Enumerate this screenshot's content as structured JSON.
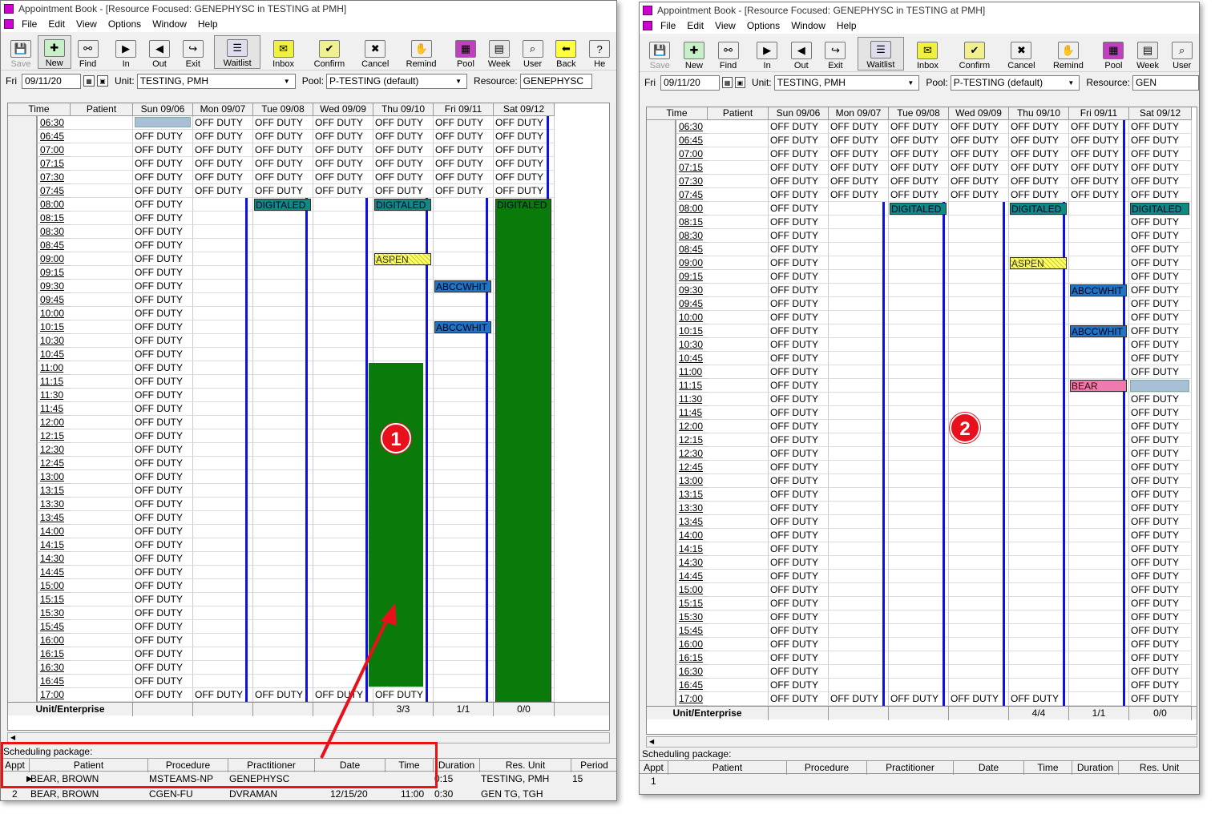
{
  "windows": [
    {
      "title": "Appointment Book - [Resource Focused:  GENEPHYSC in TESTING at PMH]",
      "menu": [
        "File",
        "Edit",
        "View",
        "Options",
        "Window",
        "Help"
      ],
      "toolbar": [
        {
          "label": "Save",
          "icon": "save-icon",
          "state": "disabled"
        },
        {
          "label": "New",
          "icon": "new-appointment-icon",
          "state": "pressed"
        },
        {
          "label": "Find",
          "icon": "binoculars-icon",
          "state": "normal"
        },
        {
          "label": "In",
          "icon": "check-in-icon",
          "state": "normal"
        },
        {
          "label": "Out",
          "icon": "check-out-icon",
          "state": "normal"
        },
        {
          "label": "Exit",
          "icon": "exit-icon",
          "state": "normal"
        },
        {
          "label": "Waitlist",
          "icon": "waitlist-icon",
          "state": "pressed"
        },
        {
          "label": "Inbox",
          "icon": "inbox-icon",
          "state": "normal"
        },
        {
          "label": "Confirm",
          "icon": "confirm-icon",
          "state": "normal"
        },
        {
          "label": "Cancel",
          "icon": "cancel-basket-icon",
          "state": "normal"
        },
        {
          "label": "Remind",
          "icon": "remind-icon",
          "state": "normal"
        },
        {
          "label": "Pool",
          "icon": "pool-grid-icon",
          "state": "normal"
        },
        {
          "label": "Week",
          "icon": "week-grid-icon",
          "state": "normal"
        },
        {
          "label": "User",
          "icon": "user-magnifier-icon",
          "state": "normal"
        },
        {
          "label": "Back",
          "icon": "back-arrow-icon",
          "state": "normal"
        },
        {
          "label": "He",
          "icon": "help-icon",
          "state": "normal"
        }
      ],
      "filter": {
        "day": "Fri",
        "date": "09/11/20",
        "unit_label": "Unit:",
        "unit": "TESTING, PMH",
        "pool_label": "Pool:",
        "pool": "P-TESTING (default)",
        "resource_label": "Resource:",
        "resource": "GENEPHYSC"
      },
      "columns": [
        "Time",
        "Patient",
        "Sun 09/06",
        "Mon 09/07",
        "Tue 09/08",
        "Wed 09/09",
        "Thu 09/10",
        "Fri 09/11",
        "Sat 09/12"
      ],
      "off_duty": "OFF DUTY",
      "appointments": [
        {
          "day": 2,
          "start": 6,
          "rows": 1,
          "text": "DIGITALED",
          "style": "teal"
        },
        {
          "day": 4,
          "start": 6,
          "rows": 1,
          "text": "DIGITALED",
          "style": "teal"
        },
        {
          "day": 6,
          "start": 6,
          "rows": 37,
          "text": "DIGITALED",
          "style": "teal-tall"
        },
        {
          "day": 4,
          "start": 10,
          "rows": 1,
          "text": "ASPEN",
          "style": "hatch"
        },
        {
          "day": 5,
          "start": 12,
          "rows": 1,
          "text": "ABCCWHIT",
          "style": "blue"
        },
        {
          "day": 5,
          "start": 15,
          "rows": 1,
          "text": "ABCCWHIT",
          "style": "blue"
        }
      ],
      "footer": {
        "label": "Unit/Enterprise",
        "counts": [
          "",
          "",
          "",
          "",
          "3/3",
          "1/1",
          "0/0"
        ]
      },
      "package": {
        "label": "Scheduling package:",
        "headers": [
          "Appt",
          "Patient",
          "Procedure",
          "Practitioner",
          "Date",
          "Time",
          "Duration",
          "Res. Unit",
          "Period"
        ],
        "rows": [
          {
            "appt": "",
            "patient": "BEAR, BROWN",
            "procedure": "MSTEAMS-NP",
            "practitioner": "GENEPHYSC",
            "date": "",
            "time": "",
            "duration": "0:15",
            "unit": "TESTING, PMH",
            "period": "15"
          },
          {
            "appt": "2",
            "patient": "BEAR, BROWN",
            "procedure": "CGEN-FU",
            "practitioner": "DVRAMAN",
            "date": "12/15/20",
            "time": "11:00",
            "duration": "0:30",
            "unit": "GEN TG, TGH",
            "period": ""
          }
        ]
      },
      "badge": "1"
    },
    {
      "title": "Appointment Book - [Resource Focused:  GENEPHYSC in TESTING at PMH]",
      "menu": [
        "File",
        "Edit",
        "View",
        "Options",
        "Window",
        "Help"
      ],
      "toolbar": [
        {
          "label": "Save",
          "icon": "save-icon",
          "state": "disabled"
        },
        {
          "label": "New",
          "icon": "new-appointment-icon",
          "state": "normal"
        },
        {
          "label": "Find",
          "icon": "binoculars-icon",
          "state": "normal"
        },
        {
          "label": "In",
          "icon": "check-in-icon",
          "state": "normal"
        },
        {
          "label": "Out",
          "icon": "check-out-icon",
          "state": "normal"
        },
        {
          "label": "Exit",
          "icon": "exit-icon",
          "state": "normal"
        },
        {
          "label": "Waitlist",
          "icon": "waitlist-icon",
          "state": "pressed"
        },
        {
          "label": "Inbox",
          "icon": "inbox-icon",
          "state": "normal"
        },
        {
          "label": "Confirm",
          "icon": "confirm-icon",
          "state": "normal"
        },
        {
          "label": "Cancel",
          "icon": "cancel-basket-icon",
          "state": "normal"
        },
        {
          "label": "Remind",
          "icon": "remind-icon",
          "state": "normal"
        },
        {
          "label": "Pool",
          "icon": "pool-grid-icon",
          "state": "normal"
        },
        {
          "label": "Week",
          "icon": "week-grid-icon",
          "state": "normal"
        },
        {
          "label": "User",
          "icon": "user-magnifier-icon",
          "state": "normal"
        }
      ],
      "filter": {
        "day": "Fri",
        "date": "09/11/20",
        "unit_label": "Unit:",
        "unit": "TESTING, PMH",
        "pool_label": "Pool:",
        "pool": "P-TESTING (default)",
        "resource_label": "Resource:",
        "resource": "GEN"
      },
      "columns": [
        "Time",
        "Patient",
        "Sun 09/06",
        "Mon 09/07",
        "Tue 09/08",
        "Wed 09/09",
        "Thu 09/10",
        "Fri 09/11",
        "Sat 09/12"
      ],
      "off_duty": "OFF DUTY",
      "appointments": [
        {
          "day": 2,
          "start": 6,
          "rows": 1,
          "text": "DIGITALED",
          "style": "teal"
        },
        {
          "day": 4,
          "start": 6,
          "rows": 1,
          "text": "DIGITALED",
          "style": "teal"
        },
        {
          "day": 6,
          "start": 6,
          "rows": 1,
          "text": "DIGITALED",
          "style": "teal"
        },
        {
          "day": 4,
          "start": 10,
          "rows": 1,
          "text": "ASPEN",
          "style": "hatch"
        },
        {
          "day": 5,
          "start": 12,
          "rows": 1,
          "text": "ABCCWHIT",
          "style": "blue"
        },
        {
          "day": 5,
          "start": 15,
          "rows": 1,
          "text": "ABCCWHIT",
          "style": "blue"
        },
        {
          "day": 5,
          "start": 19,
          "rows": 1,
          "text": "BEAR",
          "style": "pink"
        },
        {
          "day": 6,
          "start": 19,
          "rows": 1,
          "text": "",
          "style": "lblue"
        }
      ],
      "footer": {
        "label": "Unit/Enterprise",
        "counts": [
          "",
          "",
          "",
          "",
          "4/4",
          "1/1",
          "0/0"
        ]
      },
      "package": {
        "label": "Scheduling package:",
        "headers": [
          "Appt",
          "Patient",
          "Procedure",
          "Practitioner",
          "Date",
          "Time",
          "Duration",
          "Res. Unit"
        ],
        "rows": [
          {
            "appt": "1",
            "patient": "",
            "procedure": "",
            "practitioner": "",
            "date": "",
            "time": "",
            "duration": "",
            "unit": ""
          }
        ]
      },
      "badge": "2"
    }
  ],
  "times": [
    "06:30",
    "06:45",
    "07:00",
    "07:15",
    "07:30",
    "07:45",
    "08:00",
    "08:15",
    "08:30",
    "08:45",
    "09:00",
    "09:15",
    "09:30",
    "09:45",
    "10:00",
    "10:15",
    "10:30",
    "10:45",
    "11:00",
    "11:15",
    "11:30",
    "11:45",
    "12:00",
    "12:15",
    "12:30",
    "12:45",
    "13:00",
    "13:15",
    "13:30",
    "13:45",
    "14:00",
    "14:15",
    "14:30",
    "14:45",
    "15:00",
    "15:15",
    "15:30",
    "15:45",
    "16:00",
    "16:15",
    "16:30",
    "16:45",
    "17:00"
  ],
  "colors": {
    "accent_red": "#e8111b",
    "schedule_green": "#0a7a0a",
    "divider_blue": "#1010e0"
  }
}
